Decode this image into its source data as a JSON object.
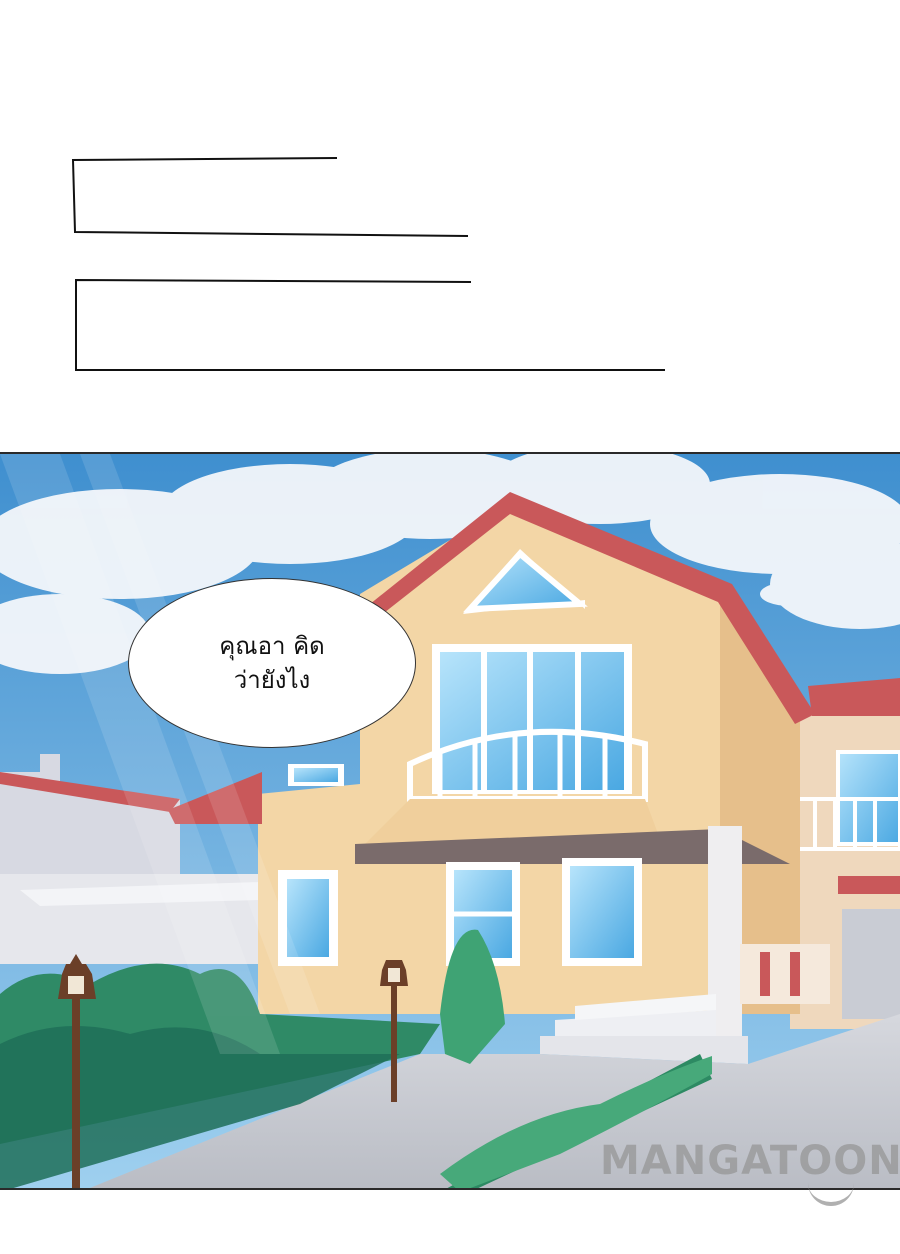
{
  "speech_bubble": {
    "line1": "คุณอา คิด",
    "line2": "ว่ายังไง"
  },
  "watermark": {
    "text": "MANGATOON"
  },
  "colors": {
    "sky": "#5aa9dd",
    "roof": "#c45a58",
    "wall": "#f3d6a6",
    "window": "#6fc2ee",
    "hedge": "#3f9a6a",
    "pavement": "#c8cbd2"
  }
}
